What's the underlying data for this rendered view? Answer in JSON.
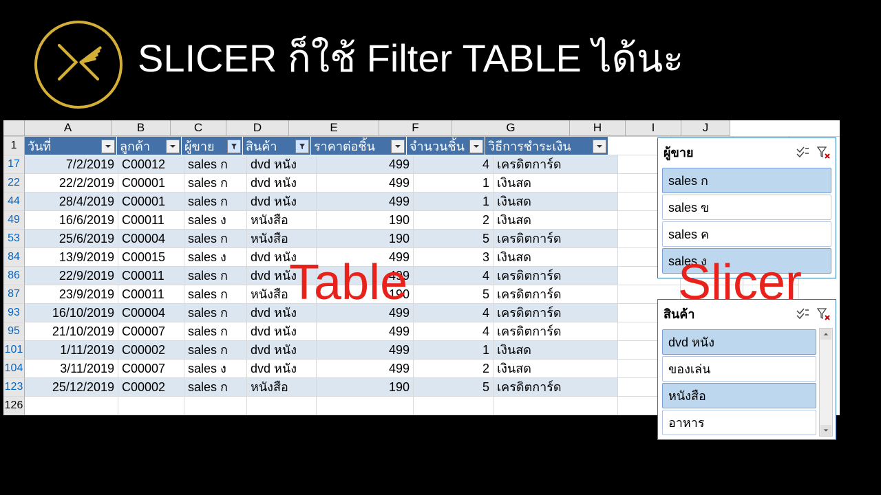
{
  "title": "SLICER ก็ใช้ Filter TABLE ได้นะ",
  "overlay1": "Table",
  "overlay2": "Slicer",
  "columns": [
    "A",
    "B",
    "C",
    "D",
    "E",
    "F",
    "G",
    "H",
    "I",
    "J"
  ],
  "firstRowNum": "1",
  "lastRowNum": "126",
  "headers": {
    "date": "วันที่",
    "cust": "ลูกค้า",
    "seller": "ผู้ขาย",
    "prod": "สินค้า",
    "price": "ราคาต่อชิ้น",
    "qty": "จำนวนชิ้น",
    "pay": "วิธีการชำระเงิน"
  },
  "rows": [
    {
      "n": "17",
      "d": "7/2/2019",
      "c": "C00012",
      "s": "sales ก",
      "p": "dvd หนัง",
      "pr": "499",
      "q": "4",
      "pay": "เครดิตการ์ด",
      "band": 1
    },
    {
      "n": "22",
      "d": "22/2/2019",
      "c": "C00001",
      "s": "sales ก",
      "p": "dvd หนัง",
      "pr": "499",
      "q": "1",
      "pay": "เงินสด",
      "band": 0
    },
    {
      "n": "44",
      "d": "28/4/2019",
      "c": "C00001",
      "s": "sales ก",
      "p": "dvd หนัง",
      "pr": "499",
      "q": "1",
      "pay": "เงินสด",
      "band": 1
    },
    {
      "n": "49",
      "d": "16/6/2019",
      "c": "C00011",
      "s": "sales ง",
      "p": "หนังสือ",
      "pr": "190",
      "q": "2",
      "pay": "เงินสด",
      "band": 0
    },
    {
      "n": "53",
      "d": "25/6/2019",
      "c": "C00004",
      "s": "sales ก",
      "p": "หนังสือ",
      "pr": "190",
      "q": "5",
      "pay": "เครดิตการ์ด",
      "band": 1
    },
    {
      "n": "84",
      "d": "13/9/2019",
      "c": "C00015",
      "s": "sales ง",
      "p": "dvd หนัง",
      "pr": "499",
      "q": "3",
      "pay": "เงินสด",
      "band": 0
    },
    {
      "n": "86",
      "d": "22/9/2019",
      "c": "C00011",
      "s": "sales ก",
      "p": "dvd หนัง",
      "pr": "499",
      "q": "4",
      "pay": "เครดิตการ์ด",
      "band": 1
    },
    {
      "n": "87",
      "d": "23/9/2019",
      "c": "C00011",
      "s": "sales ก",
      "p": "หนังสือ",
      "pr": "190",
      "q": "5",
      "pay": "เครดิตการ์ด",
      "band": 0
    },
    {
      "n": "93",
      "d": "16/10/2019",
      "c": "C00004",
      "s": "sales ก",
      "p": "dvd หนัง",
      "pr": "499",
      "q": "4",
      "pay": "เครดิตการ์ด",
      "band": 1
    },
    {
      "n": "95",
      "d": "21/10/2019",
      "c": "C00007",
      "s": "sales ก",
      "p": "dvd หนัง",
      "pr": "499",
      "q": "4",
      "pay": "เครดิตการ์ด",
      "band": 0
    },
    {
      "n": "101",
      "d": "1/11/2019",
      "c": "C00002",
      "s": "sales ก",
      "p": "dvd หนัง",
      "pr": "499",
      "q": "1",
      "pay": "เงินสด",
      "band": 1
    },
    {
      "n": "104",
      "d": "3/11/2019",
      "c": "C00007",
      "s": "sales ง",
      "p": "dvd หนัง",
      "pr": "499",
      "q": "2",
      "pay": "เงินสด",
      "band": 0
    },
    {
      "n": "123",
      "d": "25/12/2019",
      "c": "C00002",
      "s": "sales ก",
      "p": "หนังสือ",
      "pr": "190",
      "q": "5",
      "pay": "เครดิตการ์ด",
      "band": 1
    }
  ],
  "slicer1": {
    "title": "ผู้ขาย",
    "items": [
      {
        "t": "sales ก",
        "sel": 1
      },
      {
        "t": "sales ข",
        "sel": 0
      },
      {
        "t": "sales ค",
        "sel": 0
      },
      {
        "t": "sales ง",
        "sel": 1
      }
    ]
  },
  "slicer2": {
    "title": "สินค้า",
    "items": [
      {
        "t": "dvd หนัง",
        "sel": 1
      },
      {
        "t": "ของเล่น",
        "sel": 0
      },
      {
        "t": "หนังสือ",
        "sel": 1
      },
      {
        "t": "อาหาร",
        "sel": 0
      }
    ]
  }
}
